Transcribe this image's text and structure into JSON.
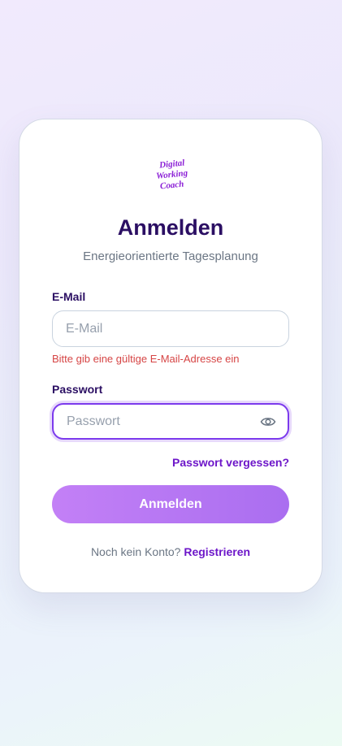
{
  "brand": {
    "logo_text": "Digital Working Coach",
    "logo_line1": "Digital",
    "logo_line2": "Working",
    "logo_line3": "Coach"
  },
  "login": {
    "title": "Anmelden",
    "subtitle": "Energieorientierte Tagesplanung",
    "email_label": "E-Mail",
    "email_placeholder": "E-Mail",
    "email_value": "",
    "email_error": "Bitte gib eine gültige E-Mail-Adresse ein",
    "password_label": "Passwort",
    "password_placeholder": "Passwort",
    "password_value": "",
    "forgot_label": "Passwort vergessen?",
    "submit_label": "Anmelden",
    "no_account_text": "Noch kein Konto?",
    "register_label": "Registrieren"
  },
  "icons": {
    "password_toggle": "eye-icon"
  },
  "colors": {
    "brand_purple": "#7c3aed",
    "title_color": "#2b0f63",
    "link_color": "#6d16c9",
    "error_color": "#d64545",
    "button_gradient_start": "#c380f6",
    "button_gradient_end": "#aa6ef0"
  }
}
